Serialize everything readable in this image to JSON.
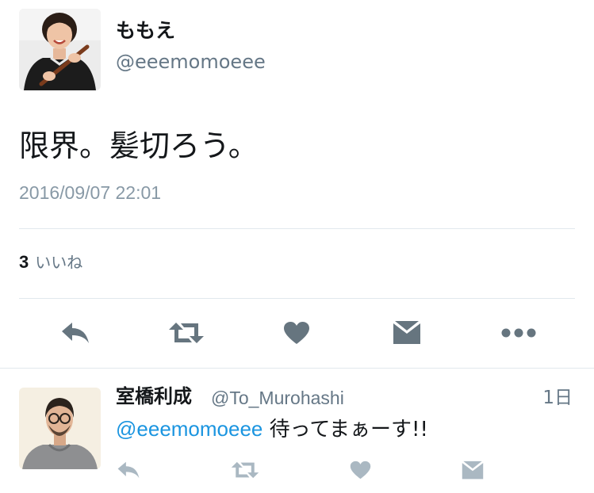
{
  "tweet": {
    "author_name": "ももえ",
    "author_handle": "@eeemomoeee",
    "text": "限界。髪切ろう。",
    "timestamp": "2016/09/07 22:01",
    "likes_count": "3",
    "likes_label": "いいね"
  },
  "reply": {
    "author_name": "室橋利成",
    "author_handle": "@To_Murohashi",
    "time": "1日",
    "mention": "@eeemomoeee",
    "text": " 待ってまぁーす!!"
  },
  "icons": {
    "reply": "reply-icon",
    "retweet": "retweet-icon",
    "like": "heart-icon",
    "dm": "envelope-icon",
    "more": "more-icon"
  },
  "colors": {
    "action_icon": "#66757f",
    "reply_action_icon": "#aab8c2",
    "mention": "#1b95e0",
    "secondary_text": "#657786",
    "divider": "#e1e8ed"
  }
}
